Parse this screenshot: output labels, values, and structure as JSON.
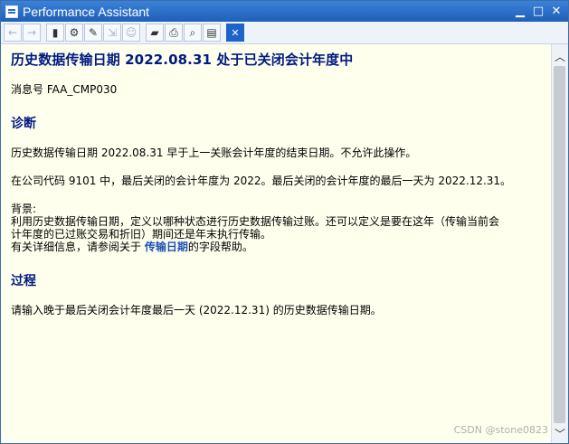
{
  "window": {
    "title": "Performance Assistant"
  },
  "toolbar": {
    "buttons": [
      {
        "icon": "arrow-left-icon",
        "glyph": "←",
        "enabled": false
      },
      {
        "icon": "arrow-right-icon",
        "glyph": "→",
        "enabled": false
      },
      {
        "icon": "book-icon",
        "glyph": "▮",
        "enabled": true
      },
      {
        "icon": "network-icon",
        "glyph": "⚙",
        "enabled": true
      },
      {
        "icon": "edit-document-icon",
        "glyph": "✎",
        "enabled": true
      },
      {
        "icon": "document-link-icon",
        "glyph": "⇲",
        "enabled": false
      },
      {
        "icon": "user-icon",
        "glyph": "☺",
        "enabled": false
      },
      {
        "icon": "folder-icon",
        "glyph": "▰",
        "enabled": true
      },
      {
        "icon": "print-icon",
        "glyph": "⎙",
        "enabled": true
      },
      {
        "icon": "find-icon",
        "glyph": "⌕",
        "enabled": true
      },
      {
        "icon": "clipboard-icon",
        "glyph": "▤",
        "enabled": true
      },
      {
        "icon": "close-icon",
        "glyph": "✕",
        "enabled": true
      }
    ]
  },
  "content": {
    "title": "历史数据传输日期 2022.08.31 处于已关闭会计年度中",
    "message_number": "消息号 FAA_CMP030",
    "diagnosis_heading": "诊断",
    "diagnosis_p1": "历史数据传输日期 2022.08.31 早于上一关账会计年度的结束日期。不允许此操作。",
    "diagnosis_p2": "在公司代码 9101 中，最后关闭的会计年度为 2022。最后关闭的会计年度的最后一天为 2022.12.31。",
    "background_label": "背景:",
    "background_line1": "利用历史数据传输日期，定义以哪种状态进行历史数据传输过账。还可以定义是要在这年（传输当前会",
    "background_line2": "计年度的已过账交易和折旧）期间还是年末执行传输。",
    "background_line3_prefix": "有关详细信息，请参阅关于 ",
    "background_link": "传输日期",
    "background_line3_suffix": "的字段帮助。",
    "procedure_heading": "过程",
    "procedure_text": "请输入晚于最后关闭会计年度最后一天 (2022.12.31) 的历史数据传输日期。"
  },
  "watermark": "CSDN @stone0823"
}
